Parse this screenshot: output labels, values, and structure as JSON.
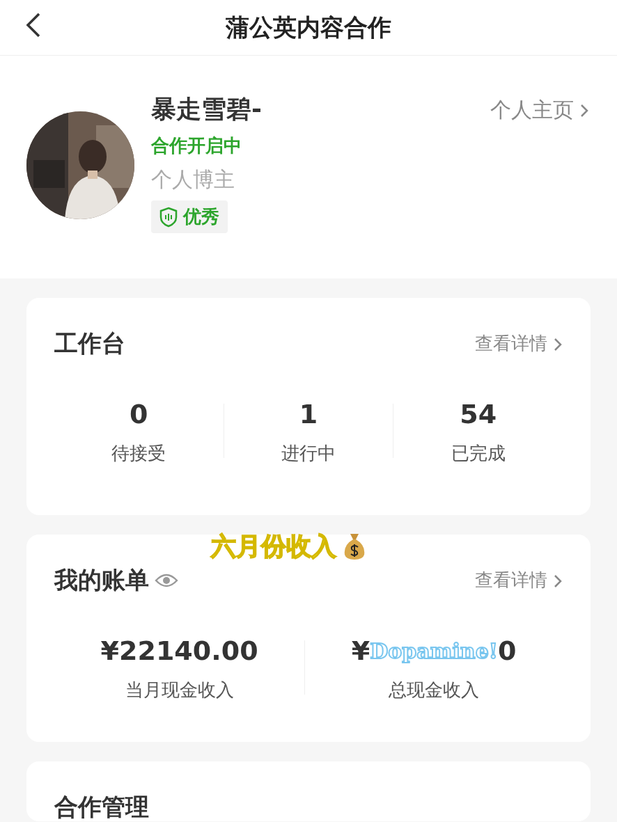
{
  "header": {
    "title": "蒲公英内容合作"
  },
  "profile": {
    "name": "暴走雪碧-",
    "status": "合作开启中",
    "type": "个人博主",
    "badge": "优秀",
    "homepage": "个人主页"
  },
  "workbench": {
    "title": "工作台",
    "details": "查看详情",
    "stats": [
      {
        "value": "0",
        "label": "待接受"
      },
      {
        "value": "1",
        "label": "进行中"
      },
      {
        "value": "54",
        "label": "已完成"
      }
    ]
  },
  "sticker": {
    "text": "六月份收入"
  },
  "bill": {
    "title": "我的账单",
    "details": "查看详情",
    "monthly": {
      "value": "¥22140.00",
      "label": "当月现金收入"
    },
    "total": {
      "value_start": "¥",
      "sticker": "Dopamine!",
      "value_end": "0",
      "label": "总现金收入"
    }
  },
  "cooperation": {
    "title": "合作管理"
  }
}
